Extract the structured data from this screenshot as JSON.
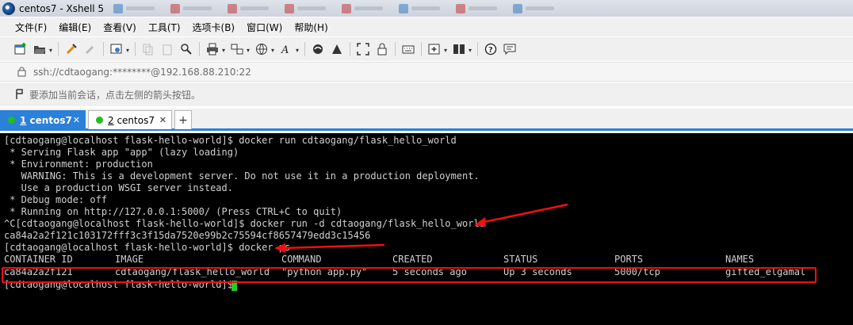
{
  "window": {
    "title": "centos7 - Xshell 5"
  },
  "menu": [
    {
      "label": "文件(F)"
    },
    {
      "label": "编辑(E)"
    },
    {
      "label": "查看(V)"
    },
    {
      "label": "工具(T)"
    },
    {
      "label": "选项卡(B)"
    },
    {
      "label": "窗口(W)"
    },
    {
      "label": "帮助(H)"
    }
  ],
  "address": {
    "text": "ssh://cdtaogang:********@192.168.88.210:22"
  },
  "hint": {
    "text": "要添加当前会话，点击左侧的箭头按钮。"
  },
  "tabs": [
    {
      "num": "1",
      "name": " centos7",
      "status_color": "#1ec01e",
      "active": true
    },
    {
      "num": "2",
      "name": " centos7",
      "status_color": "#1ec01e",
      "active": false
    }
  ],
  "terminal": {
    "lines": [
      "[cdtaogang@localhost flask-hello-world]$ docker run cdtaogang/flask_hello_world",
      " * Serving Flask app \"app\" (lazy loading)",
      " * Environment: production",
      "   WARNING: This is a development server. Do not use it in a production deployment.",
      "   Use a production WSGI server instead.",
      " * Debug mode: off",
      " * Running on http://127.0.0.1:5000/ (Press CTRL+C to quit)",
      "^C[cdtaogang@localhost flask-hello-world]$ docker run -d cdtaogang/flask_hello_world",
      "ca84a2a2f121c103172fff3c3f15da7520e99b2c75594cf8657479edd3c15456",
      "[cdtaogang@localhost flask-hello-world]$ docker ps"
    ],
    "table": {
      "headers": [
        "CONTAINER ID",
        "IMAGE",
        "COMMAND",
        "CREATED",
        "STATUS",
        "PORTS",
        "NAMES"
      ],
      "row": [
        "ca84a2a2f121",
        "cdtaogang/flask_hello_world",
        "\"python app.py\"",
        "5 seconds ago",
        "Up 3 seconds",
        "5000/tcp",
        "gifted_elgamal"
      ]
    },
    "prompt": "[cdtaogang@localhost flask-hello-world]$ "
  },
  "annotations": {
    "color": "#f01010"
  },
  "terminal_colors": {
    "background": "#000000",
    "text": "#d0d0d0",
    "cursor": "#22d022"
  }
}
